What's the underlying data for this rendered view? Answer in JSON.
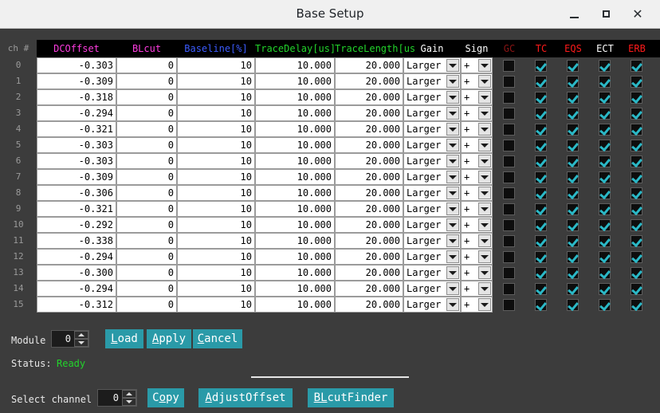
{
  "window": {
    "title": "Base Setup",
    "minimize_label": "–",
    "maximize_label": "□",
    "close_label": "✕"
  },
  "table": {
    "ch_header": "ch #",
    "columns": [
      {
        "key": "dcoffset",
        "label": "DCOffset",
        "color": "#ff3ce0"
      },
      {
        "key": "blcut",
        "label": "BLcut",
        "color": "#ff3ce0"
      },
      {
        "key": "baseline",
        "label": "Baseline[%]",
        "color": "#3c5cff"
      },
      {
        "key": "tracedelay",
        "label": "TraceDelay[us]",
        "color": "#22d42b"
      },
      {
        "key": "tracelength",
        "label": "TraceLength[us]",
        "color": "#22d42b"
      },
      {
        "key": "gain",
        "label": "Gain",
        "color": "#ffffff"
      },
      {
        "key": "sign",
        "label": "Sign",
        "color": "#ffffff"
      },
      {
        "key": "gc",
        "label": "GC",
        "color": "#8a1414"
      },
      {
        "key": "tc",
        "label": "TC",
        "color": "#ff1a1a"
      },
      {
        "key": "eqs",
        "label": "EQS",
        "color": "#ff1a1a"
      },
      {
        "key": "ect",
        "label": "ECT",
        "color": "#ffffff"
      },
      {
        "key": "erb",
        "label": "ERB",
        "color": "#ff1a1a"
      }
    ],
    "rows": [
      {
        "ch": "0",
        "dcoffset": "-0.303",
        "blcut": "0",
        "baseline": "10",
        "tracedelay": "10.000",
        "tracelength": "20.000",
        "gain": "Larger",
        "sign": "+",
        "gc": false,
        "tc": true,
        "eqs": true,
        "ect": true,
        "erb": true
      },
      {
        "ch": "1",
        "dcoffset": "-0.309",
        "blcut": "0",
        "baseline": "10",
        "tracedelay": "10.000",
        "tracelength": "20.000",
        "gain": "Larger",
        "sign": "+",
        "gc": false,
        "tc": true,
        "eqs": true,
        "ect": true,
        "erb": true
      },
      {
        "ch": "2",
        "dcoffset": "-0.318",
        "blcut": "0",
        "baseline": "10",
        "tracedelay": "10.000",
        "tracelength": "20.000",
        "gain": "Larger",
        "sign": "+",
        "gc": false,
        "tc": true,
        "eqs": true,
        "ect": true,
        "erb": true
      },
      {
        "ch": "3",
        "dcoffset": "-0.294",
        "blcut": "0",
        "baseline": "10",
        "tracedelay": "10.000",
        "tracelength": "20.000",
        "gain": "Larger",
        "sign": "+",
        "gc": false,
        "tc": true,
        "eqs": true,
        "ect": true,
        "erb": true
      },
      {
        "ch": "4",
        "dcoffset": "-0.321",
        "blcut": "0",
        "baseline": "10",
        "tracedelay": "10.000",
        "tracelength": "20.000",
        "gain": "Larger",
        "sign": "+",
        "gc": false,
        "tc": true,
        "eqs": true,
        "ect": true,
        "erb": true
      },
      {
        "ch": "5",
        "dcoffset": "-0.303",
        "blcut": "0",
        "baseline": "10",
        "tracedelay": "10.000",
        "tracelength": "20.000",
        "gain": "Larger",
        "sign": "+",
        "gc": false,
        "tc": true,
        "eqs": true,
        "ect": true,
        "erb": true
      },
      {
        "ch": "6",
        "dcoffset": "-0.303",
        "blcut": "0",
        "baseline": "10",
        "tracedelay": "10.000",
        "tracelength": "20.000",
        "gain": "Larger",
        "sign": "+",
        "gc": false,
        "tc": true,
        "eqs": true,
        "ect": true,
        "erb": true
      },
      {
        "ch": "7",
        "dcoffset": "-0.309",
        "blcut": "0",
        "baseline": "10",
        "tracedelay": "10.000",
        "tracelength": "20.000",
        "gain": "Larger",
        "sign": "+",
        "gc": false,
        "tc": true,
        "eqs": true,
        "ect": true,
        "erb": true
      },
      {
        "ch": "8",
        "dcoffset": "-0.306",
        "blcut": "0",
        "baseline": "10",
        "tracedelay": "10.000",
        "tracelength": "20.000",
        "gain": "Larger",
        "sign": "+",
        "gc": false,
        "tc": true,
        "eqs": true,
        "ect": true,
        "erb": true
      },
      {
        "ch": "9",
        "dcoffset": "-0.321",
        "blcut": "0",
        "baseline": "10",
        "tracedelay": "10.000",
        "tracelength": "20.000",
        "gain": "Larger",
        "sign": "+",
        "gc": false,
        "tc": true,
        "eqs": true,
        "ect": true,
        "erb": true
      },
      {
        "ch": "10",
        "dcoffset": "-0.292",
        "blcut": "0",
        "baseline": "10",
        "tracedelay": "10.000",
        "tracelength": "20.000",
        "gain": "Larger",
        "sign": "+",
        "gc": false,
        "tc": true,
        "eqs": true,
        "ect": true,
        "erb": true
      },
      {
        "ch": "11",
        "dcoffset": "-0.338",
        "blcut": "0",
        "baseline": "10",
        "tracedelay": "10.000",
        "tracelength": "20.000",
        "gain": "Larger",
        "sign": "+",
        "gc": false,
        "tc": true,
        "eqs": true,
        "ect": true,
        "erb": true
      },
      {
        "ch": "12",
        "dcoffset": "-0.294",
        "blcut": "0",
        "baseline": "10",
        "tracedelay": "10.000",
        "tracelength": "20.000",
        "gain": "Larger",
        "sign": "+",
        "gc": false,
        "tc": true,
        "eqs": true,
        "ect": true,
        "erb": true
      },
      {
        "ch": "13",
        "dcoffset": "-0.300",
        "blcut": "0",
        "baseline": "10",
        "tracedelay": "10.000",
        "tracelength": "20.000",
        "gain": "Larger",
        "sign": "+",
        "gc": false,
        "tc": true,
        "eqs": true,
        "ect": true,
        "erb": true
      },
      {
        "ch": "14",
        "dcoffset": "-0.294",
        "blcut": "0",
        "baseline": "10",
        "tracedelay": "10.000",
        "tracelength": "20.000",
        "gain": "Larger",
        "sign": "+",
        "gc": false,
        "tc": true,
        "eqs": true,
        "ect": true,
        "erb": true
      },
      {
        "ch": "15",
        "dcoffset": "-0.312",
        "blcut": "0",
        "baseline": "10",
        "tracedelay": "10.000",
        "tracelength": "20.000",
        "gain": "Larger",
        "sign": "+",
        "gc": false,
        "tc": true,
        "eqs": true,
        "ect": true,
        "erb": true
      }
    ]
  },
  "controls": {
    "module_label": "Module #",
    "module_value": "0",
    "load_button": {
      "mnemonic": "L",
      "rest": "oad"
    },
    "apply_button": {
      "mnemonic": "A",
      "rest": "pply"
    },
    "cancel_button": {
      "mnemonic": "C",
      "rest": "ancel"
    },
    "status_label": "Status:",
    "status_value": "Ready",
    "select_channel_label": "Select channel #",
    "select_channel_value": "0",
    "copy_button": {
      "pre": "C",
      "mnemonic": "o",
      "rest": "py"
    },
    "adjust_offset_button": {
      "mnemonic": "A",
      "rest": "djustOffset"
    },
    "blcut_finder_button": {
      "mnemonic": "BL",
      "rest": "cutFinder"
    }
  },
  "colors": {
    "accent": "#2a9aa8",
    "background": "#3c3c3c",
    "header_background": "#000000",
    "status_ok": "#22d42b",
    "check": "#2bb8c6"
  }
}
